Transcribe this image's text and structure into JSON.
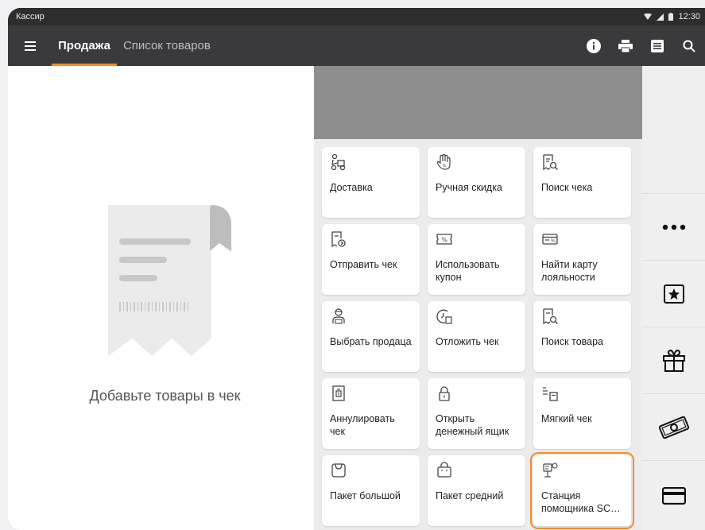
{
  "statusbar": {
    "app_name": "Кассир",
    "time": "12:30"
  },
  "appbar": {
    "tabs": [
      {
        "label": "Продажа"
      },
      {
        "label": "Список товаров"
      }
    ]
  },
  "left": {
    "empty_text": "Добавьте товары в чек"
  },
  "tiles": [
    {
      "label": "Доставка",
      "icon": "delivery-icon"
    },
    {
      "label": "Ручная скидка",
      "icon": "hand-discount-icon"
    },
    {
      "label": "Поиск чека",
      "icon": "receipt-search-icon"
    },
    {
      "label": "Отправить чек",
      "icon": "send-receipt-icon"
    },
    {
      "label": "Использовать купон",
      "icon": "coupon-icon"
    },
    {
      "label": "Найти карту лояльности",
      "icon": "loyalty-card-icon"
    },
    {
      "label": "Выбрать продаца",
      "icon": "seller-icon"
    },
    {
      "label": "Отложить чек",
      "icon": "postpone-icon"
    },
    {
      "label": "Поиск товара",
      "icon": "product-search-icon"
    },
    {
      "label": "Аннулировать чек",
      "icon": "cancel-receipt-icon"
    },
    {
      "label": "Открыть денежный ящик",
      "icon": "lock-icon"
    },
    {
      "label": "Мягкий чек",
      "icon": "soft-receipt-icon"
    },
    {
      "label": "Пакет большой",
      "icon": "bag-large-icon"
    },
    {
      "label": "Пакет средний",
      "icon": "bag-medium-icon"
    },
    {
      "label": "Станция помощника SC…",
      "icon": "assistant-station-icon"
    }
  ],
  "colors": {
    "accent": "#f28c28",
    "appbar": "#3a3a3c",
    "banner": "#8e8e8e"
  }
}
